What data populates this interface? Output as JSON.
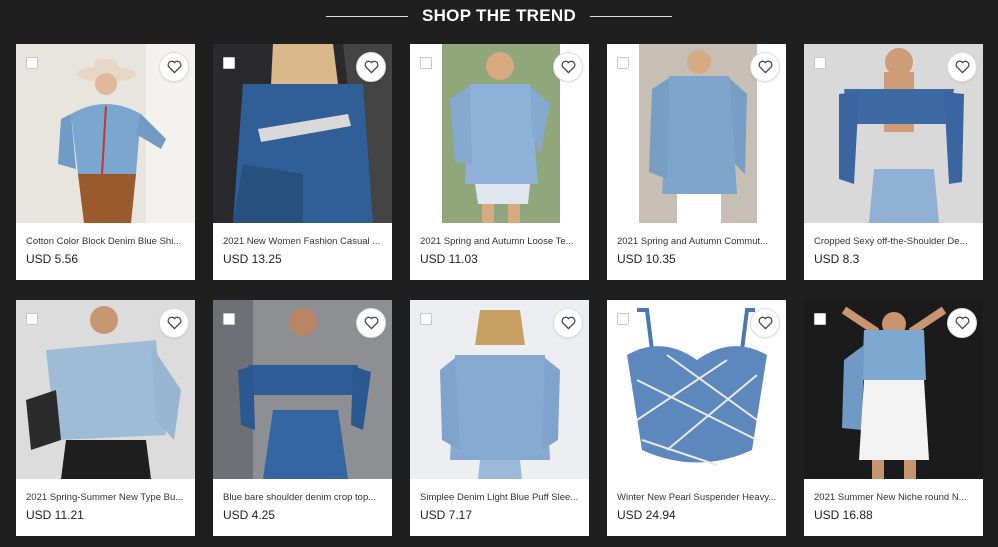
{
  "section": {
    "title": "SHOP THE TREND"
  },
  "products": [
    {
      "name": "Cotton Color Block Denim Blue Shi...",
      "price": "USD 5.56"
    },
    {
      "name": "2021 New Women Fashion Casual ...",
      "price": "USD 13.25"
    },
    {
      "name": "2021 Spring and Autumn Loose Te...",
      "price": "USD 11.03"
    },
    {
      "name": "2021 Spring and Autumn Commut...",
      "price": "USD 10.35"
    },
    {
      "name": "Cropped Sexy off-the-Shoulder De...",
      "price": "USD 8.3"
    },
    {
      "name": "2021 Spring-Summer New Type Bu...",
      "price": "USD 11.21"
    },
    {
      "name": "Blue bare shoulder denim crop top...",
      "price": "USD 4.25"
    },
    {
      "name": "Simplee Denim Light Blue Puff Slee...",
      "price": "USD 7.17"
    },
    {
      "name": "Winter New Pearl Suspender Heavy...",
      "price": "USD 24.94"
    },
    {
      "name": "2021 Summer New Niche round N...",
      "price": "USD 16.88"
    }
  ],
  "icons": {
    "wishlist": "heart-icon",
    "select": "checkbox"
  },
  "colors": {
    "background": "#1f1f1f",
    "card": "#ffffff",
    "denim": "#4a78b0"
  }
}
